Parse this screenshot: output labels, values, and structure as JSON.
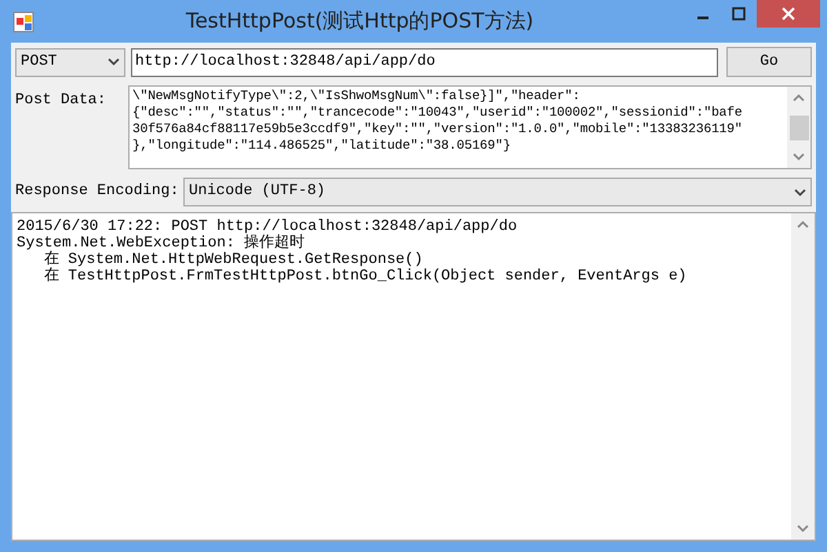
{
  "window": {
    "title": "TestHttpPost(测试Http的POST方法)"
  },
  "method": {
    "value": "POST"
  },
  "url": {
    "value": "http://localhost:32848/api/app/do"
  },
  "go_button": {
    "label": "Go"
  },
  "post_data": {
    "label": "Post Data:",
    "lines": [
      "\\\"NewMsgNotifyType\\\":2,\\\"IsShwoMsgNum\\\":false}]\",\"header\":",
      "{\"desc\":\"\",\"status\":\"\",\"trancecode\":\"10043\",\"userid\":\"100002\",\"sessionid\":\"bafe",
      "30f576a84cf88117e59b5e3ccdf9\",\"key\":\"\",\"version\":\"1.0.0\",\"mobile\":\"13383236119\"",
      "},\"longitude\":\"114.486525\",\"latitude\":\"38.05169\"}"
    ]
  },
  "response_encoding": {
    "label": "Response Encoding:",
    "value": "Unicode (UTF-8)"
  },
  "response": {
    "lines": [
      "2015/6/30 17:22: POST http://localhost:32848/api/app/do",
      "System.Net.WebException: 操作超时",
      "   在 System.Net.HttpWebRequest.GetResponse()",
      "   在 TestHttpPost.FrmTestHttpPost.btnGo_Click(Object sender, EventArgs e)"
    ]
  }
}
